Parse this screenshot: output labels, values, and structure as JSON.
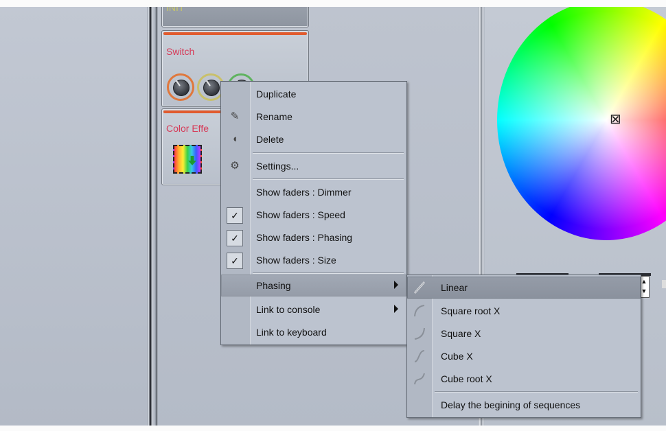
{
  "cards": {
    "init_title": "INIT",
    "switch_title": "Switch",
    "color_title": "Color Effe"
  },
  "context_menu": {
    "items": [
      {
        "label": "Duplicate",
        "icon": "none"
      },
      {
        "label": "Rename",
        "icon": "pencil-icon"
      },
      {
        "label": "Delete",
        "icon": "trash-icon"
      },
      {
        "label": "Settings...",
        "icon": "gear-icon"
      },
      {
        "label": "Show faders : Dimmer",
        "checked": false
      },
      {
        "label": "Show faders : Speed",
        "checked": true
      },
      {
        "label": "Show faders : Phasing",
        "checked": true
      },
      {
        "label": "Show faders : Size",
        "checked": true
      },
      {
        "label": "Phasing",
        "submenu": true,
        "highlighted": true
      },
      {
        "label": "Link to console",
        "submenu": true
      },
      {
        "label": "Link to keyboard"
      }
    ],
    "check_mark": "✓"
  },
  "phasing_submenu": {
    "items": [
      {
        "label": "Linear",
        "icon": "linear-curve-icon",
        "selected": true
      },
      {
        "label": "Square root X",
        "icon": "square-root-curve-icon"
      },
      {
        "label": "Square X",
        "icon": "square-curve-icon"
      },
      {
        "label": "Cube X",
        "icon": "cube-curve-icon"
      },
      {
        "label": "Cube root X",
        "icon": "cube-root-curve-icon"
      },
      {
        "label": "Delay the begining of sequences"
      }
    ]
  },
  "colors": {
    "accent_bar": "#e15b2e",
    "card_title": "#d63a58",
    "menu_bg": "#bcc3cf",
    "highlight": "#9aa1ad"
  }
}
